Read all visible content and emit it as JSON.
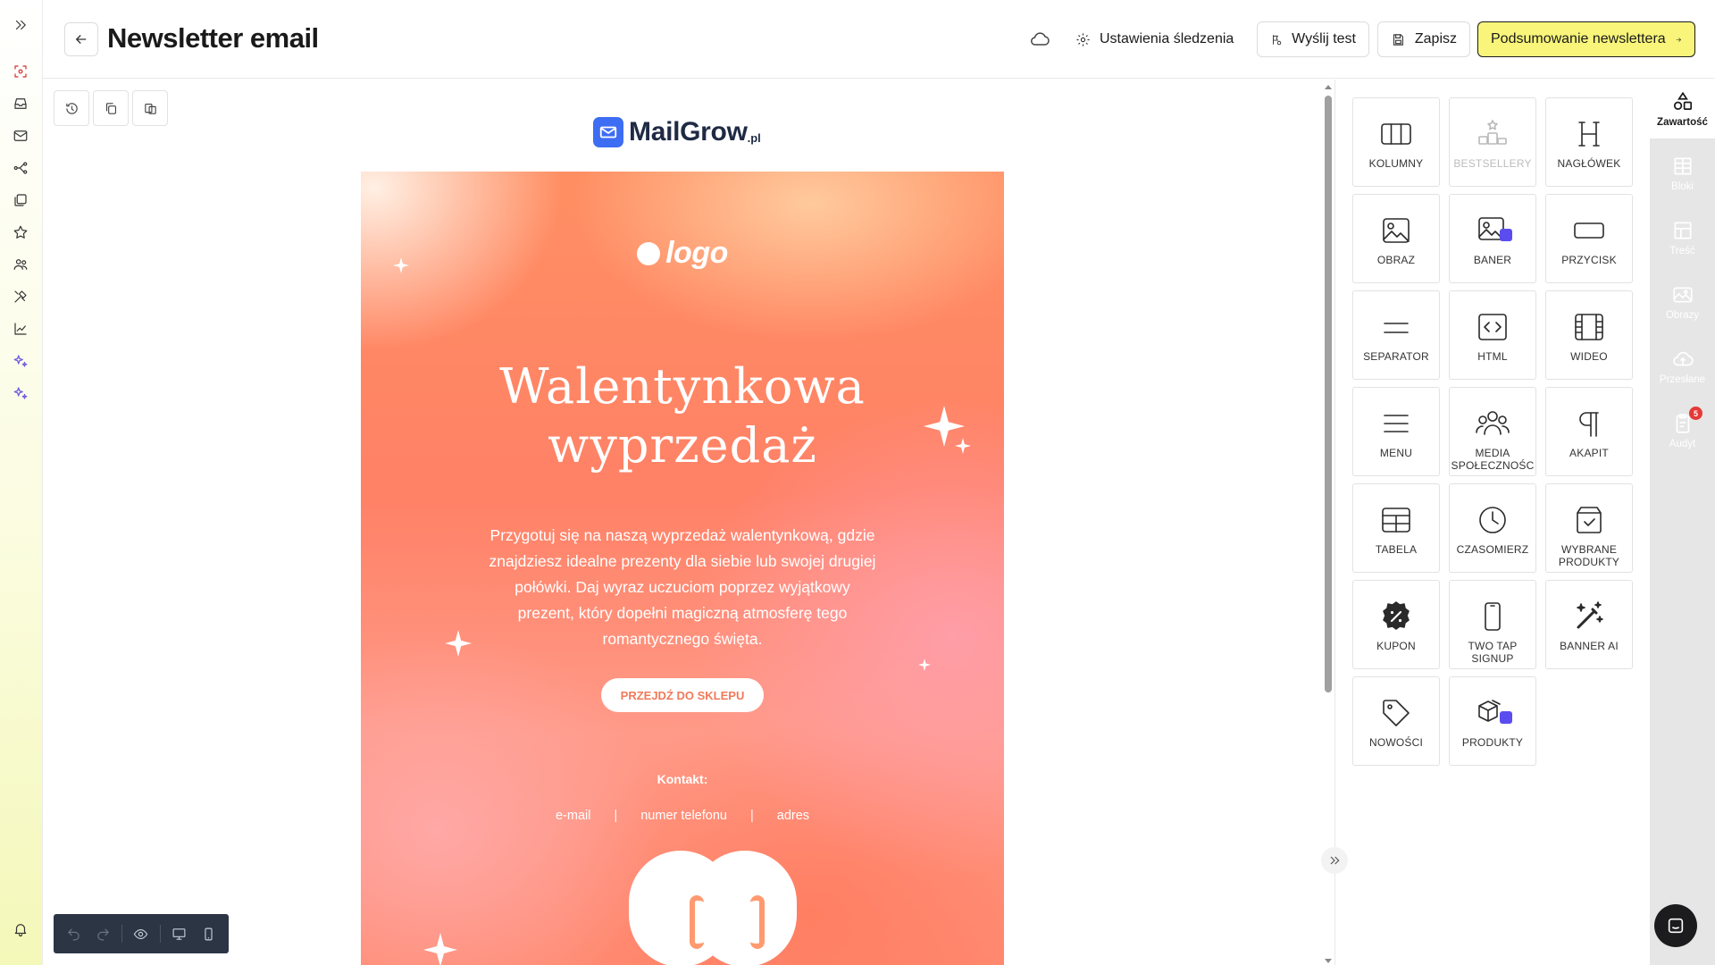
{
  "header": {
    "title": "Newsletter email",
    "tracking_label": "Ustawienia śledzenia",
    "send_test_label": "Wyślij test",
    "save_label": "Zapisz",
    "summary_label": "Podsumowanie newslettera",
    "primary_color": "#f8f57a"
  },
  "brand": {
    "name": "MailGrow",
    "tld": ".pl",
    "color": "#3d6df2"
  },
  "email": {
    "logo_text": "logo",
    "headline_line1": "Walentynkowa",
    "headline_line2": "wyprzedaż",
    "body": "Przygotuj się na naszą wyprzedaż walentynkową, gdzie znajdziesz idealne prezenty dla siebie lub swojej drugiej połówki. Daj wyraz uczuciom poprzez wyjątkowy prezent, który dopełni magiczną atmosferę tego romantycznego święta.",
    "cta_label": "PRZEJDŹ DO SKLEPU",
    "contact_heading": "Kontakt:",
    "contact_email": "e-mail",
    "contact_phone": "numer telefonu",
    "contact_address": "adres",
    "separator": "|"
  },
  "blocks": [
    {
      "label": "KOLUMNY",
      "icon": "columns-icon",
      "enabled": true
    },
    {
      "label": "BESTSELLERY",
      "icon": "bestsellers-icon",
      "enabled": false
    },
    {
      "label": "NAGŁÓWEK",
      "icon": "heading-icon",
      "enabled": true
    },
    {
      "label": "OBRAZ",
      "icon": "image-icon",
      "enabled": true
    },
    {
      "label": "BANER",
      "icon": "banner-icon",
      "enabled": true
    },
    {
      "label": "PRZYCISK",
      "icon": "button-icon",
      "enabled": true
    },
    {
      "label": "SEPARATOR",
      "icon": "separator-icon",
      "enabled": true
    },
    {
      "label": "HTML",
      "icon": "html-icon",
      "enabled": true
    },
    {
      "label": "WIDEO",
      "icon": "video-icon",
      "enabled": true
    },
    {
      "label": "MENU",
      "icon": "menu-icon",
      "enabled": true
    },
    {
      "label": "MEDIA SPOŁECZNOŚC",
      "icon": "social-media-icon",
      "enabled": true
    },
    {
      "label": "AKAPIT",
      "icon": "paragraph-icon",
      "enabled": true
    },
    {
      "label": "TABELA",
      "icon": "table-icon",
      "enabled": true
    },
    {
      "label": "CZASOMIERZ",
      "icon": "timer-icon",
      "enabled": true
    },
    {
      "label": "WYBRANE PRODUKTY",
      "icon": "selected-products-icon",
      "enabled": true
    },
    {
      "label": "KUPON",
      "icon": "coupon-icon",
      "enabled": true
    },
    {
      "label": "TWO TAP SIGNUP",
      "icon": "phone-icon",
      "enabled": true
    },
    {
      "label": "BANNER AI",
      "icon": "magic-wand-icon",
      "enabled": true
    },
    {
      "label": "NOWOŚCI",
      "icon": "tag-icon",
      "enabled": true
    },
    {
      "label": "PRODUKTY",
      "icon": "products-icon",
      "enabled": true
    }
  ],
  "side_tabs": [
    {
      "label": "Zawartość",
      "icon": "shapes-icon",
      "active": true
    },
    {
      "label": "Bloki",
      "icon": "blocks-icon",
      "active": false
    },
    {
      "label": "Treść",
      "icon": "layout-icon",
      "active": false
    },
    {
      "label": "Obrazy",
      "icon": "images-icon",
      "active": false
    },
    {
      "label": "Przesłane",
      "icon": "upload-cloud-icon",
      "active": false
    },
    {
      "label": "Audyt",
      "icon": "audit-icon",
      "active": false,
      "badge": "5"
    }
  ]
}
